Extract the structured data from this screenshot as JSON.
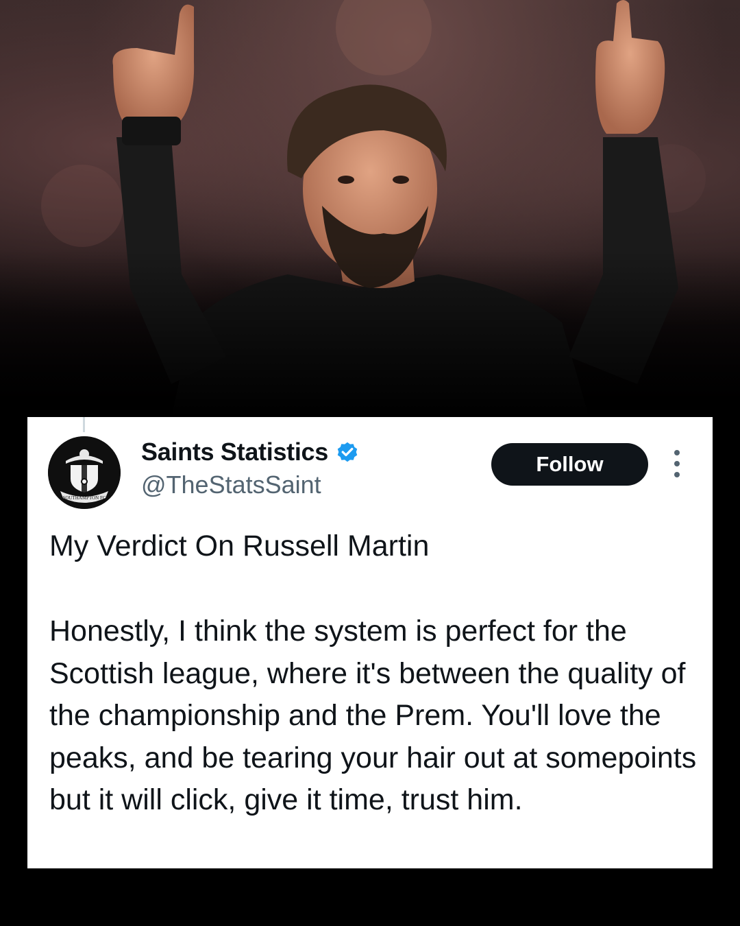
{
  "photo": {
    "description_icon": "coach-thumbs-up-photo"
  },
  "tweet": {
    "avatar_icon": "southampton-fc-crest-icon",
    "avatar_crest_text": "SOUTHAMPTON FC",
    "display_name": "Saints Statistics",
    "verified_icon": "verified-badge-icon",
    "verified_color": "#1d9bf0",
    "handle": "@TheStatsSaint",
    "follow_label": "Follow",
    "more_icon": "more-options-icon",
    "title": "My Verdict On Russell Martin",
    "body": "Honestly, I think the system is perfect for the Scottish league, where it's between the quality of the championship and the Prem. You'll love the peaks, and be tearing your hair out at somepoints but it will click, give it time, trust him."
  }
}
